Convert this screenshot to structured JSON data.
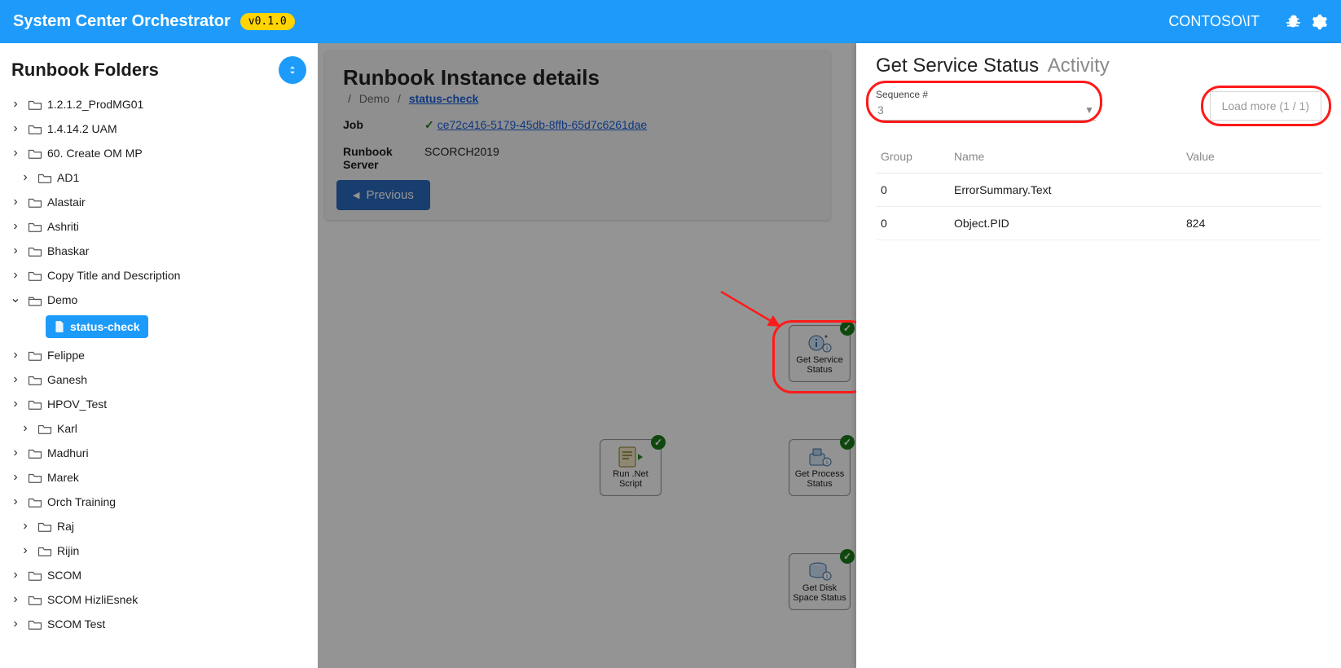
{
  "topbar": {
    "title": "System Center Orchestrator",
    "version": "v0.1.0",
    "user": "CONTOSO\\IT"
  },
  "sidebar": {
    "heading": "Runbook Folders",
    "folders": [
      {
        "label": "1.2.1.2_ProdMG01",
        "indent": 1,
        "open": false
      },
      {
        "label": "1.4.14.2 UAM",
        "indent": 1,
        "open": false
      },
      {
        "label": "60. Create OM MP",
        "indent": 1,
        "open": false
      },
      {
        "label": "AD1",
        "indent": 2,
        "open": false
      },
      {
        "label": "Alastair",
        "indent": 1,
        "open": false
      },
      {
        "label": "Ashriti",
        "indent": 1,
        "open": false
      },
      {
        "label": "Bhaskar",
        "indent": 1,
        "open": false
      },
      {
        "label": "Copy Title and Description",
        "indent": 1,
        "open": false
      },
      {
        "label": "Demo",
        "indent": 1,
        "open": true
      },
      {
        "label": "Felippe",
        "indent": 1,
        "open": false
      },
      {
        "label": "Ganesh",
        "indent": 1,
        "open": false
      },
      {
        "label": "HPOV_Test",
        "indent": 1,
        "open": false
      },
      {
        "label": "Karl",
        "indent": 2,
        "open": false
      },
      {
        "label": "Madhuri",
        "indent": 1,
        "open": false
      },
      {
        "label": "Marek",
        "indent": 1,
        "open": false
      },
      {
        "label": "Orch Training",
        "indent": 1,
        "open": false
      },
      {
        "label": "Raj",
        "indent": 2,
        "open": false
      },
      {
        "label": "Rijin",
        "indent": 2,
        "open": false
      },
      {
        "label": "SCOM",
        "indent": 1,
        "open": false
      },
      {
        "label": "SCOM HizliEsnek",
        "indent": 1,
        "open": false
      },
      {
        "label": "SCOM Test",
        "indent": 1,
        "open": false
      }
    ],
    "selected_file": "status-check"
  },
  "details": {
    "heading": "Runbook Instance details",
    "crumb1": "Demo",
    "crumb2": "status-check",
    "job_label": "Job",
    "job_link": "ce72c416-5179-45db-8ffb-65d7c6261dae",
    "server_label": "Runbook Server",
    "server_value": "SCORCH2019",
    "prev_button": "Previous"
  },
  "nodes": {
    "run": "Run .Net Script",
    "svc": "Get Service Status",
    "proc": "Get Process Status",
    "disk": "Get Disk Space Status"
  },
  "panel": {
    "title": "Get Service Status",
    "subtitle": "Activity",
    "seq_label": "Sequence #",
    "seq_value": "3",
    "loadmore": "Load more (1 / 1)",
    "head_group": "Group",
    "head_name": "Name",
    "head_value": "Value",
    "rows": [
      {
        "group": "0",
        "name": "ErrorSummary.Text",
        "value": ""
      },
      {
        "group": "0",
        "name": "Object.PID",
        "value": "824"
      }
    ]
  }
}
